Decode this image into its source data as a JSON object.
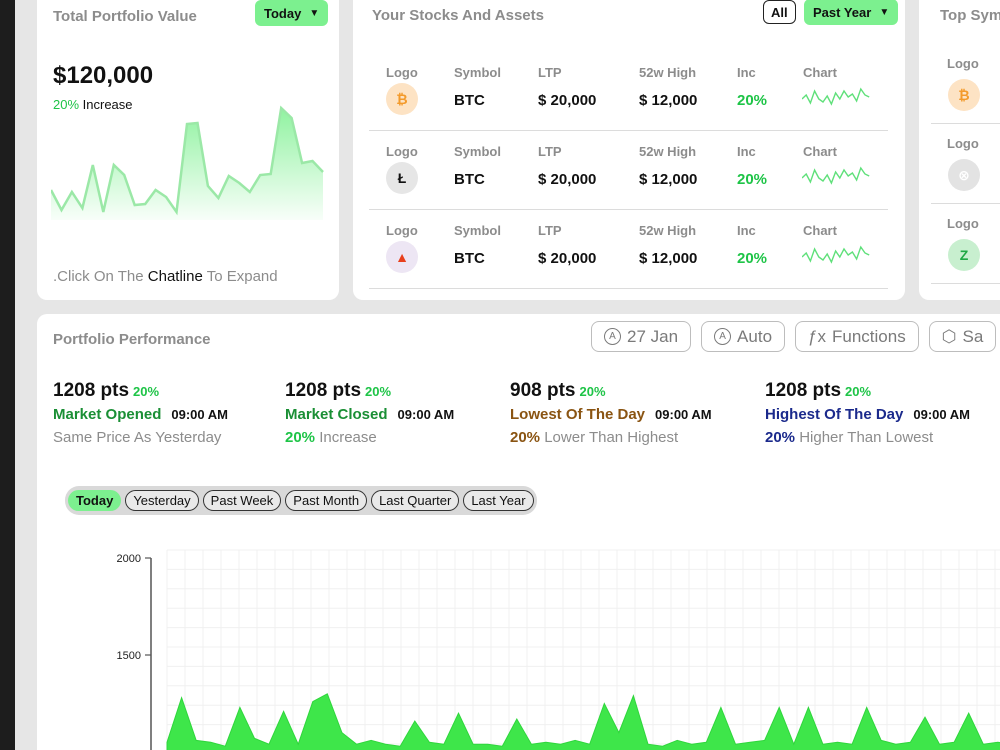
{
  "portfolio": {
    "title": "Total Portfolio Value",
    "period_select": "Today",
    "value": "$120,000",
    "change_pct": "20%",
    "change_label": "Increase",
    "hint_prefix": ".Click On The",
    "hint_bold": "Chatline",
    "hint_suffix": "To Expand",
    "sparkline": [
      30,
      10,
      28,
      12,
      55,
      8,
      55,
      45,
      15,
      16,
      30,
      23,
      8,
      96,
      97,
      34,
      22,
      44,
      37,
      28,
      45,
      46,
      112,
      102,
      57,
      59,
      48
    ]
  },
  "stocks": {
    "title": "Your Stocks And Assets",
    "filter_all": "All",
    "filter_period": "Past Year",
    "headers": {
      "logo": "Logo",
      "symbol": "Symbol",
      "ltp": "LTP",
      "high": "52w High",
      "inc": "Inc",
      "chart": "Chart"
    },
    "rows": [
      {
        "icon": "bitcoin-icon",
        "glyph": "₿",
        "symbol": "BTC",
        "ltp": "$ 20,000",
        "high": "$ 12,000",
        "inc": "20%"
      },
      {
        "icon": "litecoin-icon",
        "glyph": "Ł",
        "symbol": "BTC",
        "ltp": "$ 20,000",
        "high": "$ 12,000",
        "inc": "20%"
      },
      {
        "icon": "bat-triangle-icon",
        "glyph": "▲",
        "symbol": "BTC",
        "ltp": "$ 20,000",
        "high": "$ 12,000",
        "inc": "20%"
      }
    ]
  },
  "top_symbols": {
    "title": "Top Sym",
    "logo_header": "Logo",
    "icons": [
      "bitcoin-icon",
      "chain-icon",
      "z-coin-icon"
    ]
  },
  "performance": {
    "title": "Portfolio Performance",
    "buttons": [
      {
        "icon": "a-circle-icon",
        "label": "27 Jan"
      },
      {
        "icon": "a-circle-icon",
        "label": "Auto"
      },
      {
        "icon": "function-icon",
        "label": "Functions"
      },
      {
        "icon": "cube-icon",
        "label": "Sa"
      }
    ],
    "stats": [
      {
        "pts": "1208 pts",
        "pct": "20%",
        "label": "Market Opened",
        "time": "09:00 AM",
        "sub_pct": "",
        "sub_text": "Same Price As Yesterday",
        "color": "#1a8f35"
      },
      {
        "pts": "1208 pts",
        "pct": "20%",
        "label": "Market Closed",
        "time": "09:00 AM",
        "sub_pct": "20%",
        "sub_text": "Increase",
        "color": "#1a8f35"
      },
      {
        "pts": "908 pts",
        "pct": "20%",
        "label": "Lowest Of The Day",
        "time": "09:00 AM",
        "sub_pct": "20%",
        "sub_text": "Lower Than Highest",
        "color": "#8a5412"
      },
      {
        "pts": "1208 pts",
        "pct": "20%",
        "label": "Highest Of The Day",
        "time": "09:00 AM",
        "sub_pct": "20%",
        "sub_text": "Higher Than Lowest",
        "color": "#1b2a8c"
      }
    ],
    "ranges": [
      "Today",
      "Yesterday",
      "Past Week",
      "Past Month",
      "Last Quarter",
      "Last Year"
    ],
    "active_range": "Today"
  },
  "chart_data": {
    "type": "area",
    "title": "",
    "xlabel": "",
    "ylabel": "",
    "ylim": [
      1000,
      2000
    ],
    "y_ticks": [
      "2000",
      "1500"
    ],
    "grid": true,
    "series": [
      {
        "values": [
          1050,
          1280,
          1060,
          1050,
          1030,
          1230,
          1070,
          1040,
          1210,
          1040,
          1260,
          1300,
          1100,
          1040,
          1060,
          1040,
          1030,
          1160,
          1050,
          1040,
          1200,
          1040,
          1040,
          1030,
          1170,
          1040,
          1050,
          1040,
          1060,
          1040,
          1250,
          1100,
          1290,
          1040,
          1030,
          1060,
          1040,
          1050,
          1230,
          1040,
          1050,
          1060,
          1230,
          1040,
          1230,
          1040,
          1050,
          1040,
          1230,
          1060,
          1040,
          1050,
          1180,
          1040,
          1050,
          1200,
          1040,
          1050,
          1040,
          1200
        ]
      }
    ]
  }
}
